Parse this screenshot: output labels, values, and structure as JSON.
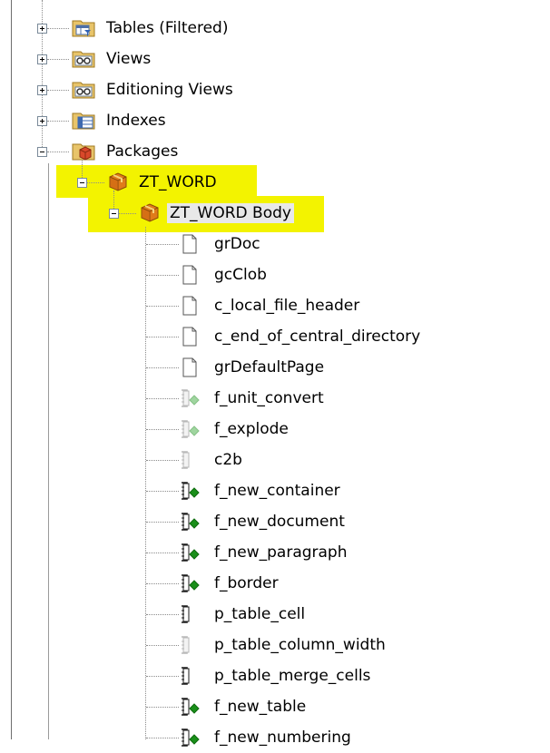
{
  "tree": {
    "object_types": [
      {
        "label": "Tables (Filtered)",
        "icon": "tables-filtered-icon",
        "expander": "plus"
      },
      {
        "label": "Views",
        "icon": "views-icon",
        "expander": "plus"
      },
      {
        "label": "Editioning Views",
        "icon": "editioning-views-icon",
        "expander": "plus"
      },
      {
        "label": "Indexes",
        "icon": "indexes-icon",
        "expander": "plus"
      },
      {
        "label": "Packages",
        "icon": "packages-icon",
        "expander": "minus"
      }
    ],
    "package": {
      "label": "ZT_WORD",
      "icon": "package-icon",
      "expander": "minus"
    },
    "package_body": {
      "label": "ZT_WORD Body",
      "icon": "package-body-icon",
      "expander": "minus"
    },
    "members": [
      {
        "label": "grDoc",
        "icon": "variable-icon"
      },
      {
        "label": "gcClob",
        "icon": "variable-icon"
      },
      {
        "label": "c_local_file_header",
        "icon": "variable-icon"
      },
      {
        "label": "c_end_of_central_directory",
        "icon": "variable-icon"
      },
      {
        "label": "grDefaultPage",
        "icon": "variable-icon"
      },
      {
        "label": "f_unit_convert",
        "icon": "private-function-icon"
      },
      {
        "label": "f_explode",
        "icon": "private-function-icon"
      },
      {
        "label": "c2b",
        "icon": "private-procedure-icon"
      },
      {
        "label": "f_new_container",
        "icon": "public-function-icon"
      },
      {
        "label": "f_new_document",
        "icon": "public-function-icon"
      },
      {
        "label": "f_new_paragraph",
        "icon": "public-function-icon"
      },
      {
        "label": "f_border",
        "icon": "public-function-icon"
      },
      {
        "label": "p_table_cell",
        "icon": "public-procedure-icon"
      },
      {
        "label": "p_table_column_width",
        "icon": "private-procedure-icon"
      },
      {
        "label": "p_table_merge_cells",
        "icon": "public-procedure-icon"
      },
      {
        "label": "f_new_table",
        "icon": "public-function-icon"
      },
      {
        "label": "f_new_numbering",
        "icon": "public-function-icon"
      }
    ]
  },
  "highlight_color": "#f3f300"
}
